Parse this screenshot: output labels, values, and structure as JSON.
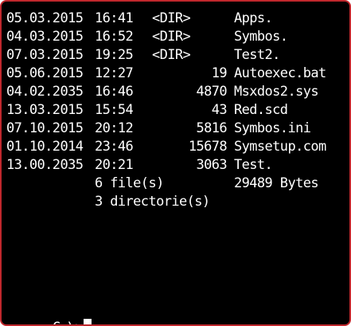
{
  "listing": [
    {
      "date": "05.03.2015",
      "time": "16:41",
      "dir": "<DIR>",
      "size": "",
      "name": "Apps."
    },
    {
      "date": "04.03.2015",
      "time": "16:52",
      "dir": "<DIR>",
      "size": "",
      "name": "Symbos."
    },
    {
      "date": "07.03.2015",
      "time": "19:25",
      "dir": "<DIR>",
      "size": "",
      "name": "Test2."
    },
    {
      "date": "05.06.2015",
      "time": "12:27",
      "dir": "",
      "size": "19",
      "name": "Autoexec.bat"
    },
    {
      "date": "04.02.2035",
      "time": "16:46",
      "dir": "",
      "size": "4870",
      "name": "Msxdos2.sys"
    },
    {
      "date": "13.03.2015",
      "time": "15:54",
      "dir": "",
      "size": "43",
      "name": "Red.scd"
    },
    {
      "date": "07.10.2015",
      "time": "20:12",
      "dir": "",
      "size": "5816",
      "name": "Symbos.ini"
    },
    {
      "date": "01.10.2014",
      "time": "23:46",
      "dir": "",
      "size": "15678",
      "name": "Symsetup.com"
    },
    {
      "date": "13.00.2035",
      "time": "20:21",
      "dir": "",
      "size": "3063",
      "name": "Test."
    }
  ],
  "summary": {
    "files": "6 file(s)",
    "bytes": "29489 Bytes",
    "directories": "3 directorie(s)"
  },
  "prompt": "C:\\>",
  "colors": {
    "background": "#000000",
    "text": "#ffffff",
    "frame": "#c0282d"
  }
}
